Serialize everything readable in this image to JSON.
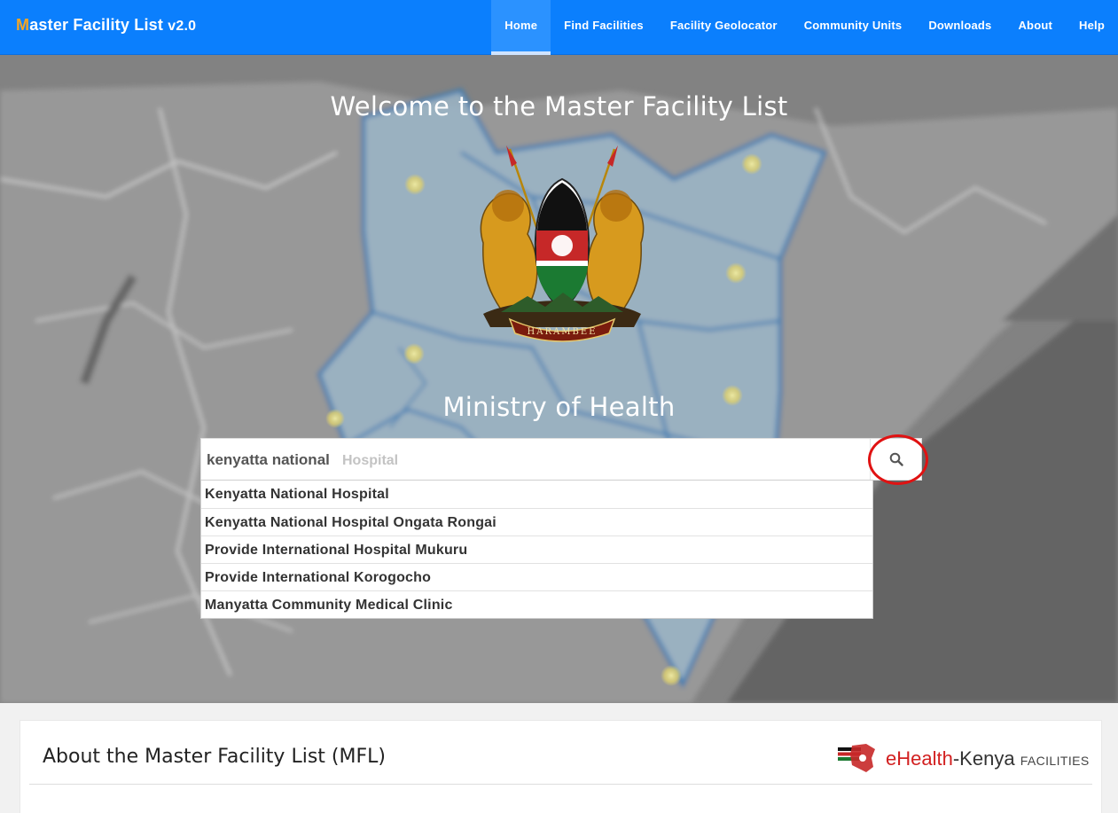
{
  "brand": {
    "first_letter": "M",
    "rest": "aster Facility List ",
    "version": "v2.0"
  },
  "nav": {
    "home": "Home",
    "find_facilities": "Find Facilities",
    "facility_geolocator": "Facility Geolocator",
    "community_units": "Community Units",
    "downloads": "Downloads",
    "about": "About",
    "help": "Help"
  },
  "hero": {
    "title": "Welcome to the Master Facility List",
    "subtitle": "Ministry of Health",
    "coat_motto": "HARAMBEE"
  },
  "search": {
    "typed_value": "kenyatta national",
    "autocomplete_hint": "Hospital",
    "suggestions": [
      "Kenyatta National Hospital",
      "Kenyatta National Hospital Ongata Rongai",
      "Provide International Hospital Mukuru",
      "Provide International Korogocho",
      "Manyatta Community Medical Clinic"
    ]
  },
  "about": {
    "title": "About the Master Facility List (MFL)",
    "logo": {
      "e": "eHealth",
      "k": "-Kenya",
      "f": "FACILITIES"
    }
  },
  "colors": {
    "navbar": "#0b7ffd",
    "accent": "#f5a623",
    "highlight": "#e01212"
  }
}
